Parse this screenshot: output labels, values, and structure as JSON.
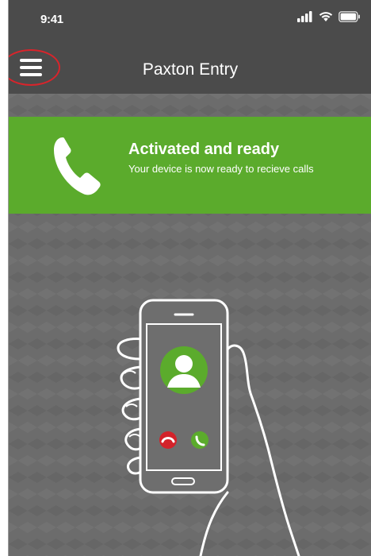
{
  "status_bar": {
    "time": "9:41",
    "icons": [
      "signal-icon",
      "wifi-icon",
      "battery-icon"
    ]
  },
  "nav": {
    "title": "Paxton Entry",
    "menu_icon": "hamburger-menu-icon"
  },
  "banner": {
    "icon": "phone-handset-icon",
    "title": "Activated and ready",
    "subtitle": "Your device is now ready to recieve calls"
  },
  "illustration": {
    "icons": [
      "avatar-icon",
      "decline-call-icon",
      "accept-call-icon"
    ]
  },
  "colors": {
    "header_bg": "#4b4b4b",
    "banner_green": "#5bab2c",
    "background_gray": "#6c6c6c",
    "decline_red": "#d3222a",
    "accept_green": "#5bab2c",
    "annotation_red": "#d9242b"
  }
}
